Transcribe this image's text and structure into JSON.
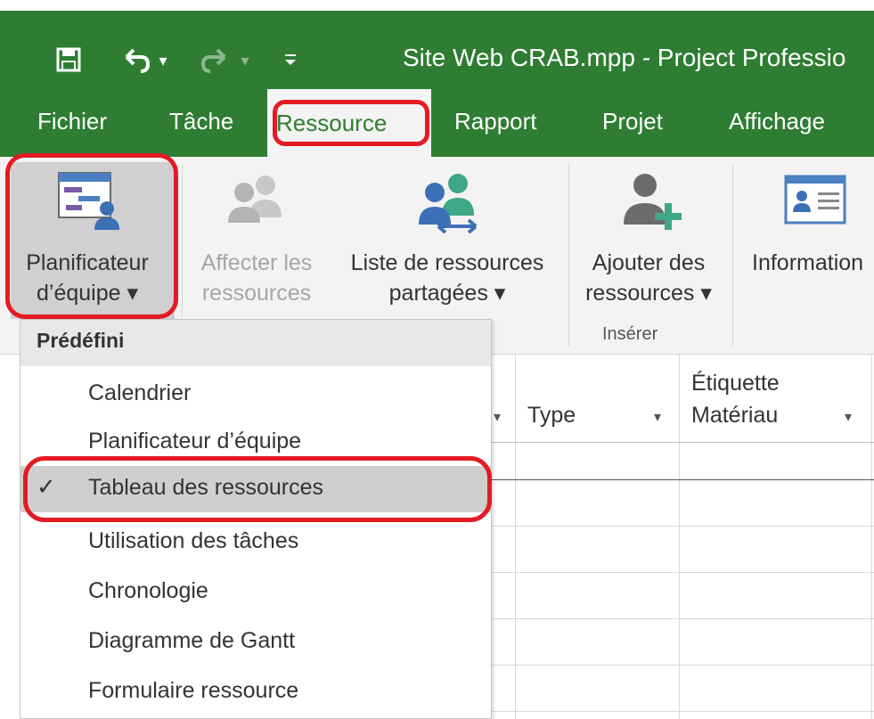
{
  "window": {
    "doc_title": "Site Web CRAB.mpp  -  Project Professio"
  },
  "quick_access": {
    "save_icon": "save-icon",
    "undo_icon": "undo-icon",
    "redo_icon": "redo-icon",
    "customize_icon": "customize-qat-icon"
  },
  "tabs": [
    {
      "label": "Fichier"
    },
    {
      "label": "Tâche"
    },
    {
      "label": "Ressource"
    },
    {
      "label": "Rapport"
    },
    {
      "label": "Projet"
    },
    {
      "label": "Affichage"
    }
  ],
  "ribbon": {
    "team_planner": {
      "line1": "Planificateur",
      "line2": "d’équipe ▾"
    },
    "assign_resources": {
      "line1": "Affecter les",
      "line2": "ressources"
    },
    "resource_pool": {
      "line1": "Liste de ressources",
      "line2": "partagées ▾"
    },
    "add_resources": {
      "line1": "Ajouter des",
      "line2": "ressources ▾"
    },
    "information": {
      "line1": "Information"
    },
    "insert_group_label": "Insérer"
  },
  "grid": {
    "columns": [
      {
        "label": "Type"
      },
      {
        "label_line1": "Étiquette",
        "label_line2": "Matériau"
      }
    ]
  },
  "menu": {
    "header": "Prédéfini",
    "items": [
      {
        "label": "Calendrier"
      },
      {
        "label": "Planificateur d’équipe"
      },
      {
        "label": "Tableau des ressources",
        "checked": true
      },
      {
        "label": "Utilisation des tâches"
      },
      {
        "label": "Chronologie"
      },
      {
        "label": "Diagramme de Gantt"
      },
      {
        "label": "Formulaire ressource"
      }
    ],
    "check_glyph": "✓"
  },
  "colors": {
    "accent": "#2e7d32",
    "annotation": "#e31b23"
  }
}
